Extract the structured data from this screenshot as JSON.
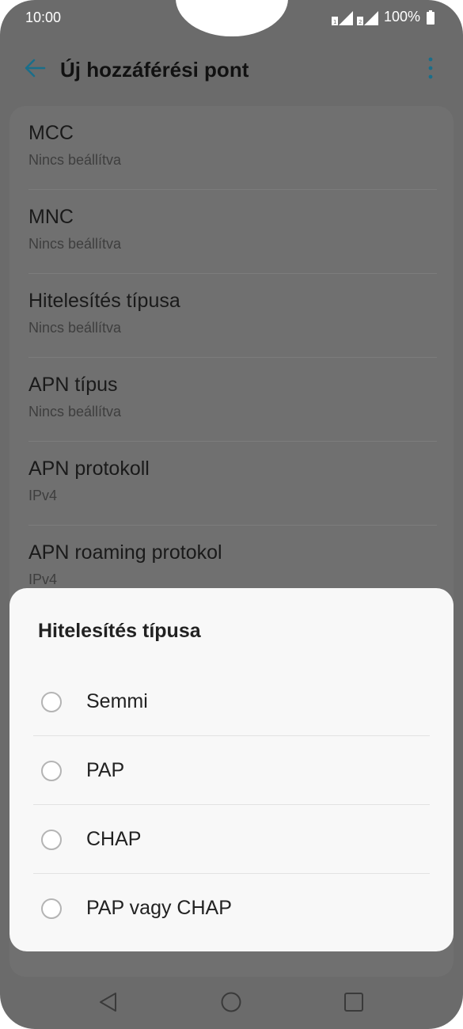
{
  "status_bar": {
    "time": "10:00",
    "battery_percent": "100%"
  },
  "app_bar": {
    "title": "Új hozzáférési pont",
    "back_icon": "arrow-left-icon",
    "more_icon": "more-vert-icon"
  },
  "settings": {
    "items": [
      {
        "title": "MCC",
        "value": "Nincs beállítva"
      },
      {
        "title": "MNC",
        "value": "Nincs beállítva"
      },
      {
        "title": "Hitelesítés típusa",
        "value": "Nincs beállítva"
      },
      {
        "title": "APN típus",
        "value": "Nincs beállítva"
      },
      {
        "title": "APN protokoll",
        "value": "IPv4"
      },
      {
        "title": "APN roaming protokol",
        "value": "IPv4"
      }
    ]
  },
  "dialog": {
    "title": "Hitelesítés típusa",
    "options": [
      {
        "label": "Semmi",
        "selected": false
      },
      {
        "label": "PAP",
        "selected": false
      },
      {
        "label": "CHAP",
        "selected": false
      },
      {
        "label": "PAP vagy CHAP",
        "selected": false
      }
    ]
  },
  "nav_bar": {
    "back_icon": "triangle-back-icon",
    "home_icon": "circle-home-icon",
    "recents_icon": "square-recents-icon"
  },
  "colors": {
    "accent": "#1a6e8a",
    "scrim": "#6b6b6b",
    "dialog_bg": "#f8f8f8"
  }
}
